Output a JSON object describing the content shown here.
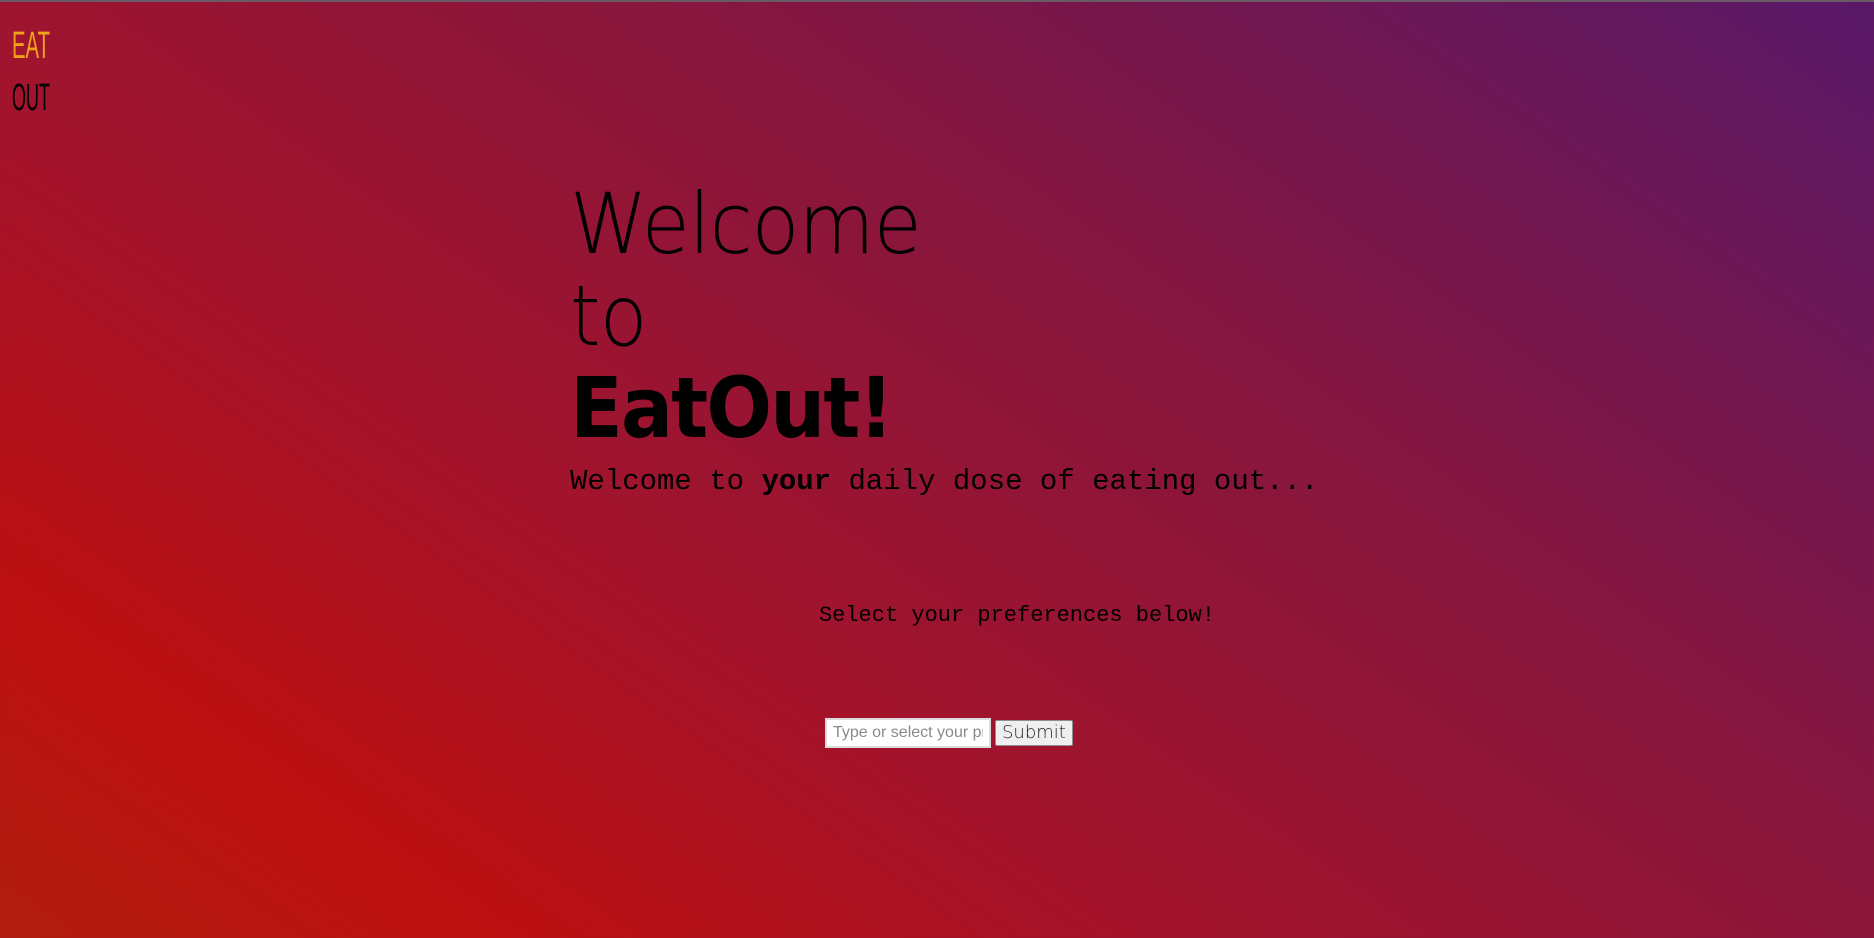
{
  "logo": {
    "line1": "EAT",
    "line2": "OUT",
    "color_top": "#f0a21a",
    "color_bottom": "#000000"
  },
  "hero": {
    "line1": "Welcome",
    "line2": "to",
    "brand": "EatOut!"
  },
  "subtitle": {
    "before": "Welcome to ",
    "emphasis": "your",
    "after": " daily dose of eating out..."
  },
  "prompt": "Select your preferences below!",
  "form": {
    "input_placeholder": "Type or select your preferences",
    "input_value": "",
    "submit_label": "Submit"
  },
  "colors": {
    "gradient_top_right": "#581868",
    "gradient_mid": "#a5132a",
    "gradient_bottom_left": "#bd1010"
  }
}
